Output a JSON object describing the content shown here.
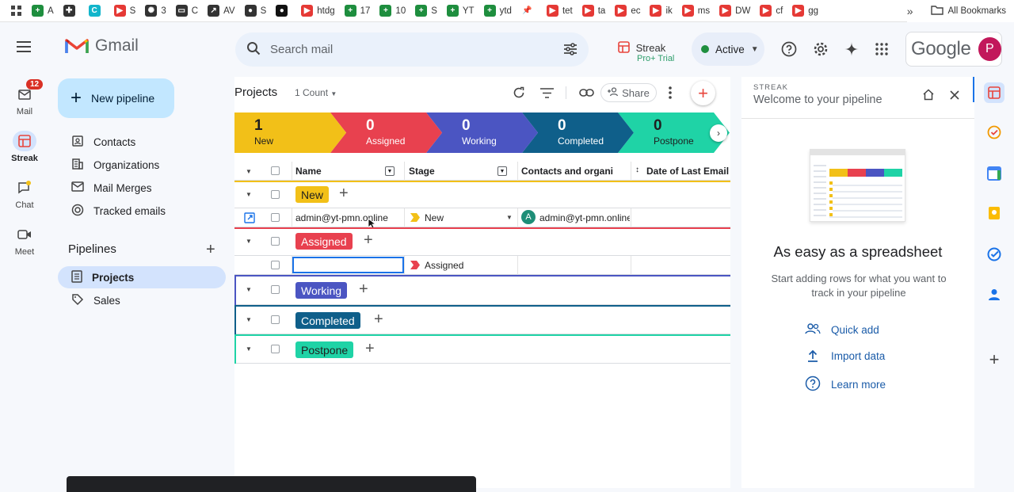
{
  "bookmarks": [
    {
      "label": "A",
      "icon": "sheets-icon",
      "color": "#1e8e3e"
    },
    {
      "label": "",
      "icon": "puzzle-icon",
      "color": "#333333"
    },
    {
      "label": "",
      "icon": "canva-icon",
      "color": "#12b5cb"
    },
    {
      "label": "S",
      "icon": "youtube-icon",
      "color": "#e53935"
    },
    {
      "label": "3",
      "icon": "openai-icon",
      "color": "#333333"
    },
    {
      "label": "C",
      "icon": "folder-icon",
      "color": "#333333"
    },
    {
      "label": "AV",
      "icon": "trend-icon",
      "color": "#333333"
    },
    {
      "label": "S",
      "icon": "globe-icon",
      "color": "#333333"
    },
    {
      "label": "",
      "icon": "github-icon",
      "color": "#111111"
    },
    {
      "label": "htdg",
      "icon": "youtube-icon",
      "color": "#e53935"
    },
    {
      "label": "17",
      "icon": "sheets-icon",
      "color": "#1e8e3e"
    },
    {
      "label": "10",
      "icon": "sheets-icon",
      "color": "#1e8e3e"
    },
    {
      "label": "S",
      "icon": "sheets-icon",
      "color": "#1e8e3e"
    },
    {
      "label": "YT",
      "icon": "sheets-icon",
      "color": "#1e8e3e"
    },
    {
      "label": "ytd",
      "icon": "sheets-icon",
      "color": "#1e8e3e"
    },
    {
      "label": "",
      "icon": "pin-icon",
      "color": "#333333"
    },
    {
      "label": "tet",
      "icon": "youtube-icon",
      "color": "#e53935"
    },
    {
      "label": "ta",
      "icon": "youtube-icon",
      "color": "#e53935"
    },
    {
      "label": "ec",
      "icon": "youtube-icon",
      "color": "#e53935"
    },
    {
      "label": "ik",
      "icon": "youtube-icon",
      "color": "#e53935"
    },
    {
      "label": "ms",
      "icon": "youtube-icon",
      "color": "#e53935"
    },
    {
      "label": "DW",
      "icon": "youtube-icon",
      "color": "#e53935"
    },
    {
      "label": "cf",
      "icon": "youtube-icon",
      "color": "#e53935"
    },
    {
      "label": "gg",
      "icon": "youtube-icon",
      "color": "#e53935"
    }
  ],
  "bookmarks_more": "»",
  "all_bookmarks": "All Bookmarks",
  "rail": {
    "mail": "Mail",
    "mail_badge": "12",
    "streak": "Streak",
    "chat": "Chat",
    "meet": "Meet"
  },
  "gmail_title": "Gmail",
  "search_placeholder": "Search mail",
  "streak_brand": {
    "name": "Streak",
    "trial": "Pro+ Trial"
  },
  "status_label": "Active",
  "avatar_letter": "P",
  "google_word": "Google",
  "left_nav": {
    "new_pipeline": "New pipeline",
    "items": [
      "Contacts",
      "Organizations",
      "Mail Merges",
      "Tracked emails"
    ],
    "pipelines_heading": "Pipelines",
    "pipelines": [
      "Projects",
      "Sales"
    ]
  },
  "pipeline": {
    "title": "Projects",
    "count": "1 Count",
    "share": "Share"
  },
  "stages": [
    {
      "count": "1",
      "label": "New",
      "color": "#f2c018",
      "text": "#1f1f1f"
    },
    {
      "count": "0",
      "label": "Assigned",
      "color": "#e8414f",
      "text": "#ffffff"
    },
    {
      "count": "0",
      "label": "Working",
      "color": "#4b55c2",
      "text": "#ffffff"
    },
    {
      "count": "0",
      "label": "Completed",
      "color": "#0f5f8a",
      "text": "#ffffff"
    },
    {
      "count": "0",
      "label": "Postpone",
      "color": "#1fd3a6",
      "text": "#1f1f1f"
    }
  ],
  "columns": [
    "Name",
    "Stage",
    "Contacts and organizations",
    "Date of Last Email"
  ],
  "groups": [
    {
      "label": "New",
      "color": "#f2c018",
      "text": "#1f1f1f"
    },
    {
      "label": "Assigned",
      "color": "#e8414f",
      "text": "#ffffff"
    },
    {
      "label": "Working",
      "color": "#4b55c2",
      "text": "#ffffff"
    },
    {
      "label": "Completed",
      "color": "#0f5f8a",
      "text": "#ffffff"
    },
    {
      "label": "Postpone",
      "color": "#1fd3a6",
      "text": "#1f1f1f"
    }
  ],
  "rows": {
    "new_row": {
      "name": "admin@yt-pmn.online",
      "stage": "New",
      "contact_initial": "A",
      "contact": "admin@yt-pmn.online"
    },
    "assigned_row": {
      "name": "",
      "stage": "Assigned"
    }
  },
  "streak_panel": {
    "kicker": "STREAK",
    "title": "Welcome to your pipeline",
    "headline": "As easy as a spreadsheet",
    "description": "Start adding rows for what you want to track in your pipeline",
    "links": [
      "Quick add",
      "Import data",
      "Learn more"
    ]
  }
}
